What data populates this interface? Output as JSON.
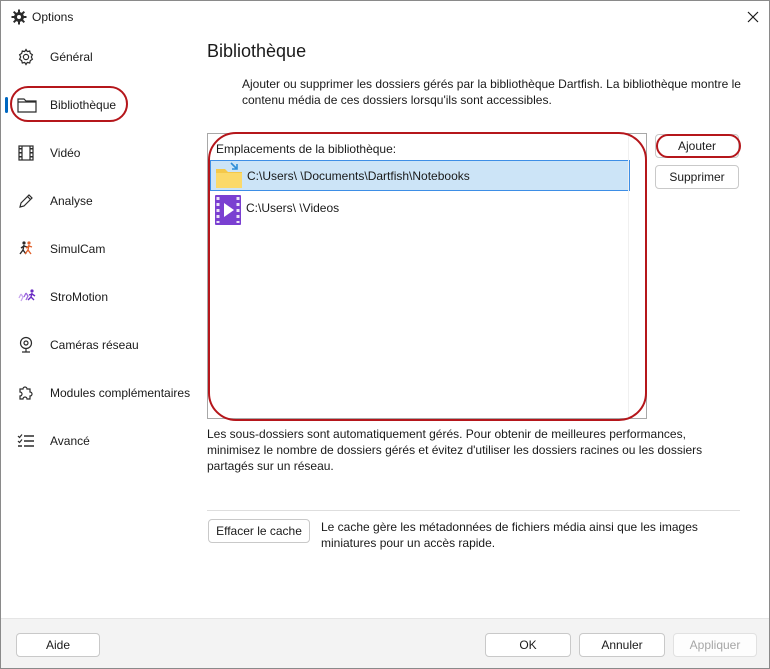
{
  "window": {
    "title": "Options",
    "icons": {
      "app": "gear-icon",
      "close": "close-icon"
    }
  },
  "sidebar": {
    "items": [
      {
        "label": "Général",
        "icon": "gear-icon"
      },
      {
        "label": "Bibliothèque",
        "icon": "folder-icon",
        "selected": true
      },
      {
        "label": "Vidéo",
        "icon": "film-strip-icon"
      },
      {
        "label": "Analyse",
        "icon": "pencil-icon"
      },
      {
        "label": "SimulCam",
        "icon": "simulcam-figures-icon"
      },
      {
        "label": "StroMotion",
        "icon": "stromotion-runner-icon"
      },
      {
        "label": "Caméras réseau",
        "icon": "webcam-icon"
      },
      {
        "label": "Modules complémentaires",
        "icon": "puzzle-icon"
      },
      {
        "label": "Avancé",
        "icon": "checklist-icon"
      }
    ]
  },
  "main": {
    "title": "Bibliothèque",
    "description": "Ajouter ou supprimer les dossiers gérés par la bibliothèque Dartfish. La bibliothèque montre le contenu média de ces dossiers lorsqu'ils sont accessibles.",
    "list": {
      "header": "Emplacements de la bibliothèque:",
      "items": [
        {
          "path": "C:\\Users\\            \\Documents\\Dartfish\\Notebooks",
          "icon": "notebooks-folder-icon",
          "selected": true
        },
        {
          "path": "C:\\Users\\            \\Videos",
          "icon": "videos-folder-icon",
          "selected": false
        }
      ]
    },
    "buttons": {
      "add": "Ajouter",
      "remove": "Supprimer"
    },
    "note": "Les sous-dossiers sont automatiquement gérés. Pour obtenir de meilleures performances, minimisez le nombre de dossiers gérés et évitez d'utiliser les dossiers racines ou les dossiers partagés sur un réseau.",
    "cache": {
      "button": "Effacer le cache",
      "description": "Le cache gère les métadonnées de fichiers média ainsi que les images miniatures pour un accès rapide."
    }
  },
  "footer": {
    "help": "Aide",
    "ok": "OK",
    "cancel": "Annuler",
    "apply": "Appliquer"
  },
  "colors": {
    "accent": "#0067c0",
    "selection_bg": "#cce4f7",
    "selection_border": "#3d8ee6",
    "annotation": "#b5161b"
  }
}
